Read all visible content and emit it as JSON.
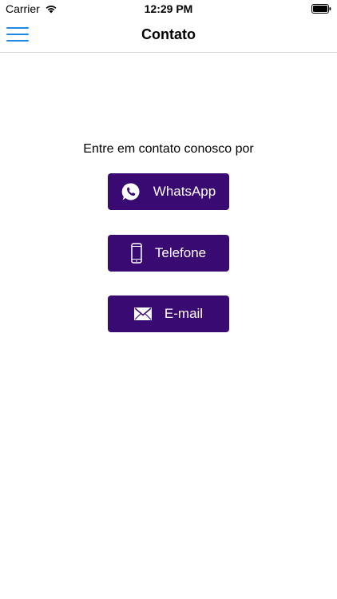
{
  "status_bar": {
    "carrier": "Carrier",
    "time": "12:29 PM"
  },
  "nav": {
    "title": "Contato",
    "menu_color": "#1e88e5"
  },
  "content": {
    "intro": "Entre em contato conosco por",
    "buttons": [
      {
        "label": "WhatsApp",
        "icon": "whatsapp-icon"
      },
      {
        "label": "Telefone",
        "icon": "phone-icon"
      },
      {
        "label": "E-mail",
        "icon": "mail-icon"
      }
    ],
    "button_color": "#3a0a73"
  }
}
